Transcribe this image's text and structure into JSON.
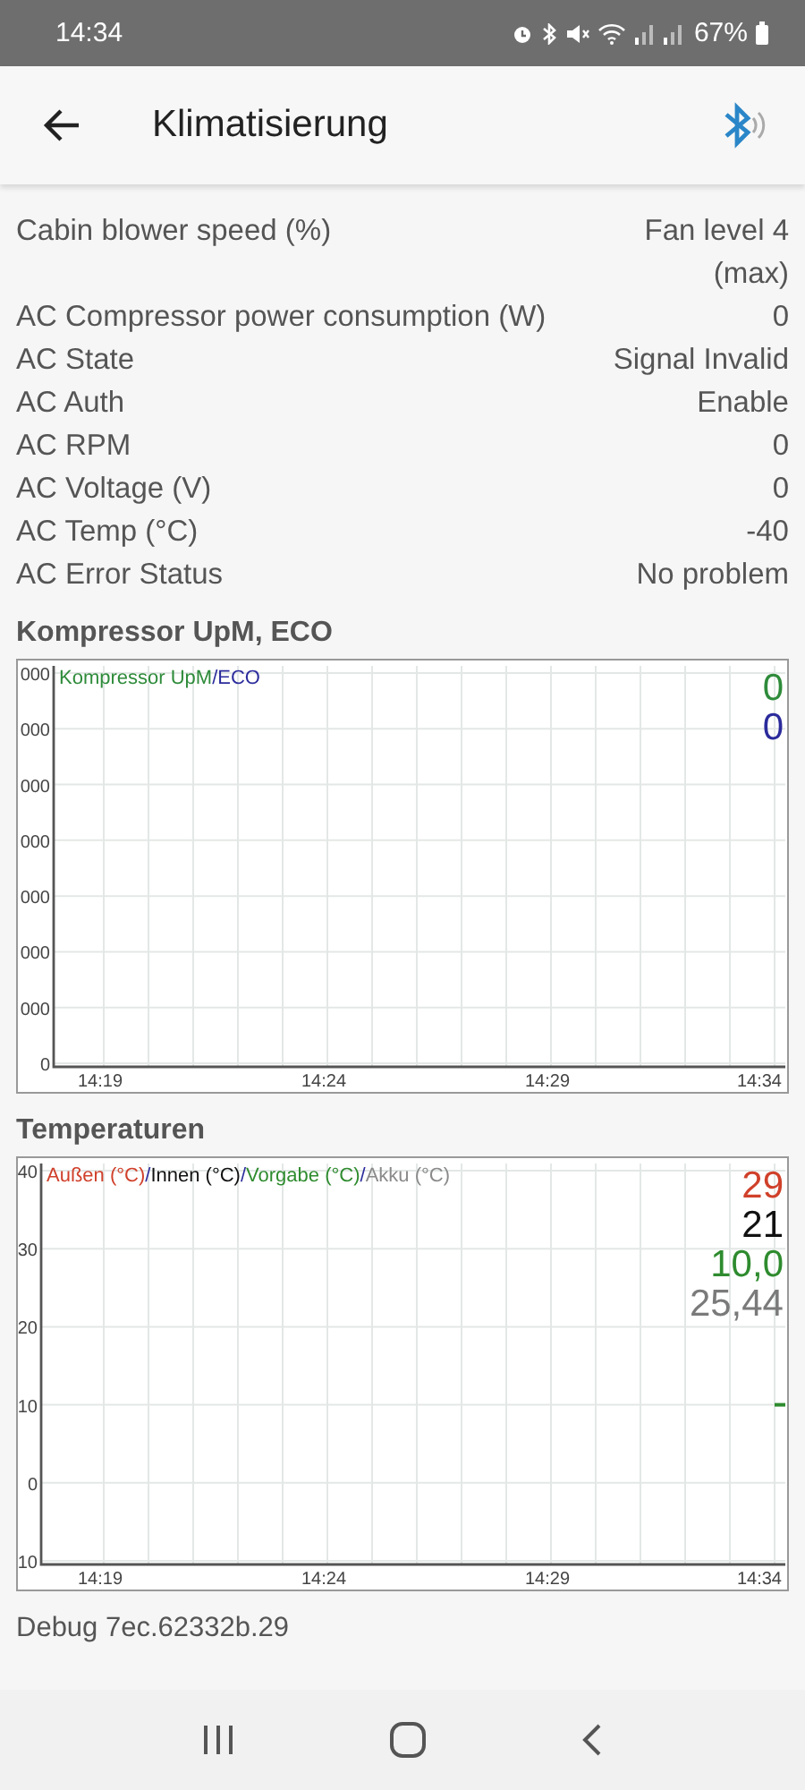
{
  "status_bar": {
    "time": "14:34",
    "battery": "67%"
  },
  "app_bar": {
    "title": "Klimatisierung"
  },
  "rows": [
    {
      "label": "Cabin blower speed (%)",
      "value": "Fan level 4 (max)"
    },
    {
      "label": "AC Compressor power consumption (W)",
      "value": "0"
    },
    {
      "label": "AC State",
      "value": "Signal Invalid"
    },
    {
      "label": "AC Auth",
      "value": "Enable"
    },
    {
      "label": "AC RPM",
      "value": "0"
    },
    {
      "label": "AC Voltage (V)",
      "value": "0"
    },
    {
      "label": "AC Temp (°C)",
      "value": "-40"
    },
    {
      "label": "AC Error Status",
      "value": "No problem"
    }
  ],
  "charts": [
    {
      "title": "Kompressor UpM, ECO",
      "separator": "/",
      "legend": [
        {
          "label": "Kompressor UpM",
          "color": "#2e8b3a"
        },
        {
          "label": "ECO",
          "color": "#2b2b9c"
        }
      ],
      "readings": [
        {
          "text": "0",
          "color": "#2e8b3a"
        },
        {
          "text": "0",
          "color": "#2b2b9c"
        }
      ],
      "y_labels": [
        "000",
        "000",
        "000",
        "000",
        "000",
        "000",
        "000",
        "0"
      ],
      "x_labels": [
        "14:19",
        "14:24",
        "14:29",
        "14:34"
      ]
    },
    {
      "title": "Temperaturen",
      "separator": "/",
      "legend": [
        {
          "label": "Außen (°C)",
          "color": "#d0402a"
        },
        {
          "label": "Innen (°C)",
          "color": "#111111"
        },
        {
          "label": "Vorgabe (°C)",
          "color": "#2e8b2e"
        },
        {
          "label": "Akku (°C)",
          "color": "#8a8a8a"
        }
      ],
      "readings": [
        {
          "text": "29",
          "color": "#d0402a"
        },
        {
          "text": "21",
          "color": "#111111"
        },
        {
          "text": "10,0",
          "color": "#2e8b2e"
        },
        {
          "text": "25,44",
          "color": "#7a7a7a"
        }
      ],
      "y_labels": [
        "40",
        "30",
        "20",
        "10",
        "0",
        "10"
      ],
      "x_labels": [
        "14:19",
        "14:24",
        "14:29",
        "14:34"
      ]
    }
  ],
  "debug": "Debug 7ec.62332b.29"
}
